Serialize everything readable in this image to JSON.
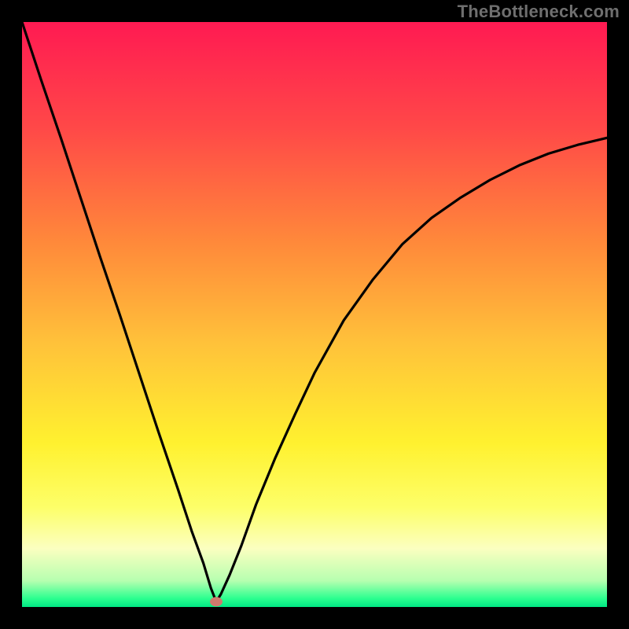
{
  "watermark": {
    "text": "TheBottleneck.com"
  },
  "chart_data": {
    "type": "line",
    "title": "",
    "xlabel": "",
    "ylabel": "",
    "xlim": [
      0,
      100
    ],
    "ylim": [
      0,
      100
    ],
    "gradient_stops": [
      {
        "offset": 0.0,
        "color": "#ff1a52"
      },
      {
        "offset": 0.18,
        "color": "#ff4848"
      },
      {
        "offset": 0.38,
        "color": "#ff8a3a"
      },
      {
        "offset": 0.55,
        "color": "#ffc23a"
      },
      {
        "offset": 0.72,
        "color": "#fff12f"
      },
      {
        "offset": 0.83,
        "color": "#fdff69"
      },
      {
        "offset": 0.9,
        "color": "#fbffc0"
      },
      {
        "offset": 0.955,
        "color": "#b7ffb0"
      },
      {
        "offset": 0.985,
        "color": "#2dff90"
      },
      {
        "offset": 1.0,
        "color": "#00e884"
      }
    ],
    "marker": {
      "x": 33.2,
      "y": 0.9,
      "color": "#cf7a6d"
    },
    "series": [
      {
        "name": "bottleneck-curve",
        "x": [
          0.0,
          3.3,
          6.7,
          10.0,
          13.3,
          16.7,
          20.0,
          23.3,
          26.7,
          29.0,
          31.0,
          32.3,
          33.2,
          34.0,
          35.5,
          37.5,
          40.0,
          43.3,
          46.7,
          50.0,
          55.0,
          60.0,
          65.0,
          70.0,
          75.0,
          80.0,
          85.0,
          90.0,
          95.0,
          100.0
        ],
        "values": [
          100.0,
          90.0,
          80.0,
          70.0,
          60.0,
          50.0,
          40.0,
          30.0,
          20.0,
          13.0,
          7.5,
          3.2,
          0.9,
          2.2,
          5.5,
          10.5,
          17.5,
          25.5,
          33.0,
          40.0,
          49.0,
          56.0,
          62.0,
          66.5,
          70.0,
          73.0,
          75.5,
          77.5,
          79.0,
          80.2
        ]
      }
    ]
  }
}
